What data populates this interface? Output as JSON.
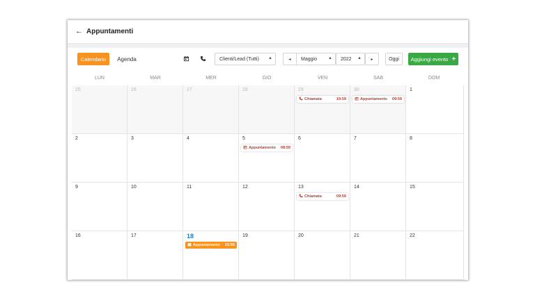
{
  "header": {
    "back_icon": "arrow-left-icon",
    "title": "Appuntamenti"
  },
  "toolbar": {
    "calendar_label": "Calendario",
    "agenda_label": "Agenda",
    "filter_value": "Clienti/Lead (Tutti)",
    "month_value": "Maggio",
    "year_value": "2022",
    "today_label": "Oggi",
    "add_label": "Aggiungi evento",
    "add_icon": "+",
    "prev_icon": "◂",
    "next_icon": "▸"
  },
  "weekdays": [
    "LUN",
    "MAR",
    "MER",
    "GIO",
    "VEN",
    "SAB",
    "DOM"
  ],
  "weeks": [
    [
      {
        "day": "25",
        "other": true
      },
      {
        "day": "26",
        "other": true
      },
      {
        "day": "27",
        "other": true
      },
      {
        "day": "28",
        "other": true
      },
      {
        "day": "29",
        "other": true,
        "event": {
          "icon": "phone-icon",
          "label": "Chiamata",
          "time": "10:59"
        }
      },
      {
        "day": "30",
        "other": true,
        "event": {
          "icon": "calendar-icon",
          "label": "Appuntamento",
          "time": "09:59"
        }
      },
      {
        "day": "1",
        "other": false
      }
    ],
    [
      {
        "day": "2"
      },
      {
        "day": "3"
      },
      {
        "day": "4"
      },
      {
        "day": "5",
        "event": {
          "icon": "calendar-icon",
          "label": "Appuntamento",
          "time": "08:59"
        }
      },
      {
        "day": "6"
      },
      {
        "day": "7"
      },
      {
        "day": "8"
      }
    ],
    [
      {
        "day": "9"
      },
      {
        "day": "10"
      },
      {
        "day": "11"
      },
      {
        "day": "12"
      },
      {
        "day": "13",
        "event": {
          "icon": "phone-icon",
          "label": "Chiamata",
          "time": "09:59"
        }
      },
      {
        "day": "14"
      },
      {
        "day": "15"
      }
    ],
    [
      {
        "day": "16"
      },
      {
        "day": "17"
      },
      {
        "day": "18",
        "today": true,
        "event": {
          "icon": "calendar-icon",
          "label": "Appuntamento",
          "time": "15:59",
          "highlight": true
        }
      },
      {
        "day": "19"
      },
      {
        "day": "20"
      },
      {
        "day": "21"
      },
      {
        "day": "22"
      }
    ]
  ],
  "colors": {
    "accent_orange": "#f7931e",
    "accent_green": "#3aa845",
    "event_red": "#c0392b",
    "today_blue": "#2979b5"
  }
}
